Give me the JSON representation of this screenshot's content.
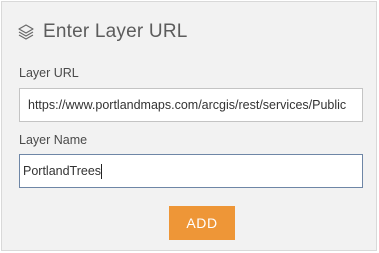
{
  "header": {
    "title": "Enter Layer URL",
    "icon": "layers-icon"
  },
  "form": {
    "url_label": "Layer URL",
    "url_value": "https://www.portlandmaps.com/arcgis/rest/services/Public",
    "name_label": "Layer Name",
    "name_value": "PortlandTrees",
    "add_label": "ADD"
  },
  "colors": {
    "panel_background": "#f2f2f2",
    "accent_button": "#ee9637",
    "focused_border": "#6e86a6"
  }
}
